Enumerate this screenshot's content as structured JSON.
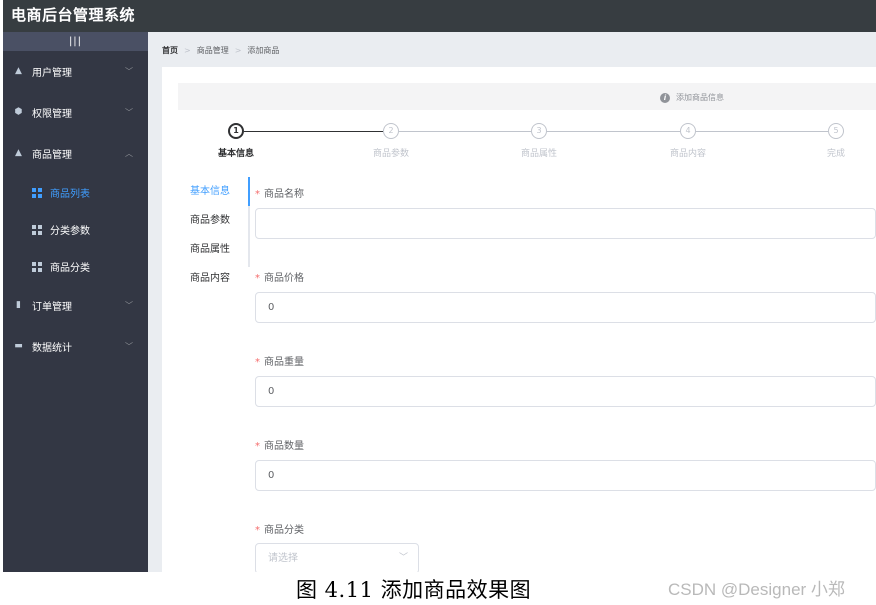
{
  "header": {
    "title": "电商后台管理系统"
  },
  "sidebar": {
    "toggle_label": "|||",
    "menus": [
      {
        "label": "用户管理",
        "icon": "user-icon",
        "glyph": "▲",
        "expanded": false
      },
      {
        "label": "权限管理",
        "icon": "shield-icon",
        "glyph": "⬢",
        "expanded": false
      },
      {
        "label": "商品管理",
        "icon": "goods-icon",
        "glyph": "▲",
        "expanded": true,
        "children": [
          {
            "label": "商品列表",
            "active": true
          },
          {
            "label": "分类参数",
            "active": false
          },
          {
            "label": "商品分类",
            "active": false
          }
        ]
      },
      {
        "label": "订单管理",
        "icon": "order-icon",
        "glyph": "▮",
        "expanded": false
      },
      {
        "label": "数据统计",
        "icon": "chart-icon",
        "glyph": "▬",
        "expanded": false
      }
    ],
    "arrow_down": "﹀",
    "arrow_up": "︿"
  },
  "breadcrumb": [
    "首页",
    "商品管理",
    "添加商品"
  ],
  "breadcrumb_sep": ">",
  "alert": {
    "icon": "info-icon",
    "glyph": "i",
    "text": "添加商品信息"
  },
  "steps": {
    "active": 1,
    "items": [
      {
        "num": "1",
        "label": "基本信息"
      },
      {
        "num": "2",
        "label": "商品参数"
      },
      {
        "num": "3",
        "label": "商品属性"
      },
      {
        "num": "4",
        "label": "商品内容"
      },
      {
        "num": "5",
        "label": "完成"
      }
    ]
  },
  "tabs": [
    {
      "label": "基本信息",
      "active": true
    },
    {
      "label": "商品参数",
      "active": false
    },
    {
      "label": "商品属性",
      "active": false
    },
    {
      "label": "商品内容",
      "active": false
    }
  ],
  "form": {
    "required_mark": "*",
    "name_label": "商品名称",
    "name_value": "",
    "price_label": "商品价格",
    "price_value": "0",
    "weight_label": "商品重量",
    "weight_value": "0",
    "number_label": "商品数量",
    "number_value": "0",
    "category_label": "商品分类",
    "category_placeholder": "请选择"
  },
  "caption": "图 4.11  添加商品效果图",
  "watermark": "CSDN @Designer 小郑",
  "colors": {
    "header_bg": "#373d41",
    "sidebar_bg": "#333744",
    "accent": "#409eff",
    "required": "#f56c6c",
    "main_bg": "#eaedf1"
  }
}
